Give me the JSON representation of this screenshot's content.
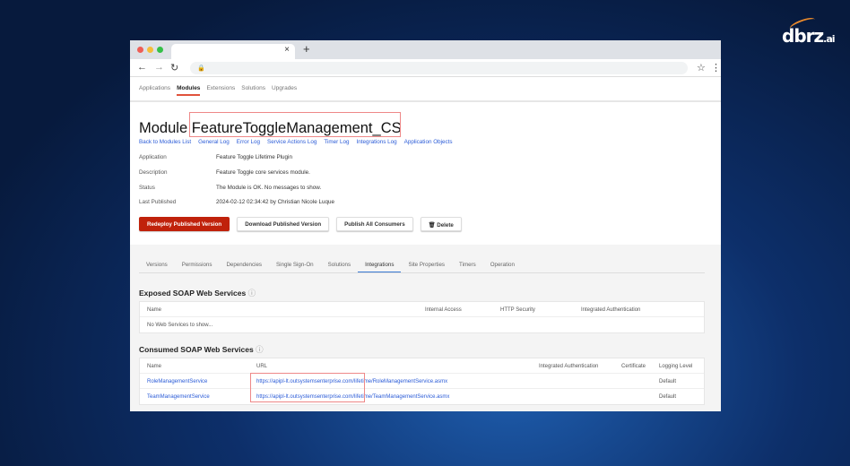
{
  "brand": {
    "logo": "dbrz",
    "logo_suffix": ".ai"
  },
  "browser": {
    "tab_close": "×",
    "new_tab": "+",
    "back": "←",
    "forward": "→",
    "reload": "↻",
    "lock": "🔒",
    "star": "☆",
    "menu": "⋮"
  },
  "nav": [
    "Applications",
    "Modules",
    "Extensions",
    "Solutions",
    "Upgrades"
  ],
  "title": {
    "prefix": "Module",
    "name": "FeatureToggleManagement_CS"
  },
  "links": [
    "Back to Modules List",
    "General Log",
    "Error Log",
    "Service Actions Log",
    "Timer Log",
    "Integrations Log",
    "Application Objects"
  ],
  "info": [
    {
      "label": "Application",
      "value": "Feature Toggle Lifetime Plugin"
    },
    {
      "label": "Description",
      "value": "Feature Toggle core services module."
    },
    {
      "label": "Status",
      "value": "The Module is OK. No messages to show."
    },
    {
      "label": "Last Published",
      "value": "2024-02-12 02:34:42  by  Christian Nicole Luque"
    }
  ],
  "buttons": {
    "redeploy": "Redeploy Published Version",
    "download": "Download Published Version",
    "publish": "Publish All Consumers",
    "delete": "Delete",
    "delete_icon": "🗑"
  },
  "tabs": [
    "Versions",
    "Permissions",
    "Dependencies",
    "Single Sign-On",
    "Solutions",
    "Integrations",
    "Site Properties",
    "Timers",
    "Operation"
  ],
  "exposed": {
    "heading": "Exposed SOAP Web Services",
    "info": "ⓘ",
    "cols": [
      "Name",
      "Internal Access",
      "HTTP Security",
      "Integrated Authentication"
    ],
    "empty": "No Web Services to show..."
  },
  "consumed": {
    "heading": "Consumed SOAP Web Services",
    "info": "ⓘ",
    "cols": [
      "Name",
      "URL",
      "Integrated Authentication",
      "Certificate",
      "Logging Level"
    ],
    "rows": [
      {
        "name": "RoleManagementService",
        "url": "https://apipl-lt.outsystemsenterprise.com/lifetime/RoleManagementService.asmx",
        "level": "Default"
      },
      {
        "name": "TeamManagementService",
        "url": "https://apipl-lt.outsystemsenterprise.com/lifetime/TeamManagementService.asmx",
        "level": "Default"
      }
    ]
  }
}
